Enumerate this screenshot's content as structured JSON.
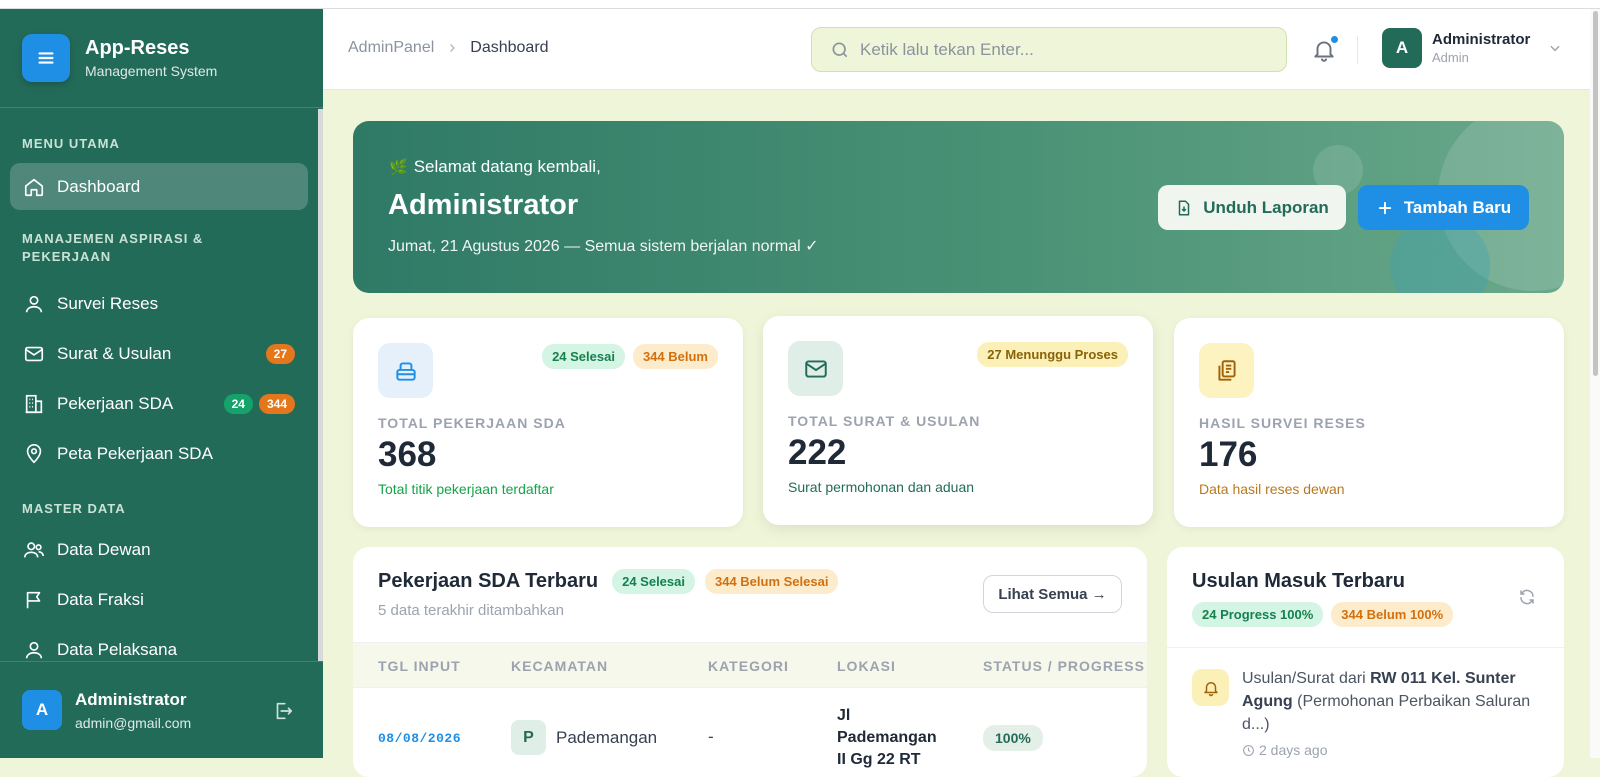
{
  "sidebar": {
    "brand_title": "App-Reses",
    "brand_subtitle": "Management System",
    "sections": [
      {
        "title": "MENU UTAMA"
      },
      {
        "title": "MANAJEMEN ASPIRASI & PEKERJAAN"
      },
      {
        "title": "MASTER DATA"
      }
    ],
    "items": [
      {
        "label": "Dashboard",
        "icon": "home-icon",
        "active": true
      },
      {
        "label": "Survei Reses",
        "icon": "user-icon"
      },
      {
        "label": "Surat & Usulan",
        "icon": "mail-icon",
        "badge": "27"
      },
      {
        "label": "Pekerjaan SDA",
        "icon": "building-icon",
        "badge_green": "24",
        "badge_orange": "344"
      },
      {
        "label": "Peta Pekerjaan SDA",
        "icon": "map-pin-icon"
      },
      {
        "label": "Data Dewan",
        "icon": "users-icon"
      },
      {
        "label": "Data Fraksi",
        "icon": "flag-icon"
      },
      {
        "label": "Data Pelaksana",
        "icon": "user-icon"
      }
    ],
    "footer": {
      "avatar": "A",
      "name": "Administrator",
      "email": "admin@gmail.com"
    }
  },
  "header": {
    "breadcrumb": [
      "AdminPanel",
      "Dashboard"
    ],
    "search_placeholder": "Ketik lalu tekan Enter...",
    "user": {
      "avatar": "A",
      "name": "Administrator",
      "role": "Admin"
    }
  },
  "hero": {
    "greeting": "Selamat datang kembali,",
    "name": "Administrator",
    "date_line": "Jumat, 21 Agustus 2026 — Semua sistem berjalan normal ✓",
    "btn_download": "Unduh Laporan",
    "btn_add": "Tambah Baru"
  },
  "stats": [
    {
      "label": "TOTAL PEKERJAAN SDA",
      "value": "368",
      "sub": "Total titik pekerjaan terdaftar",
      "pills": [
        "24 Selesai",
        "344 Belum"
      ],
      "accent": "#16a34a"
    },
    {
      "label": "TOTAL SURAT & USULAN",
      "value": "222",
      "sub": "Surat permohonan dan aduan",
      "pills": [
        "27 Menunggu Proses"
      ],
      "accent": "#236b59"
    },
    {
      "label": "HASIL SURVEI RESES",
      "value": "176",
      "sub": "Data hasil reses dewan",
      "pills": [],
      "accent": "#b7791f"
    }
  ],
  "table": {
    "title": "Pekerjaan SDA Terbaru",
    "pill_done": "24 Selesai",
    "pill_pending": "344 Belum Selesai",
    "subtitle": "5 data terakhir ditambahkan",
    "btn_all": "Lihat Semua →",
    "columns": [
      "TGL INPUT",
      "KECAMATAN",
      "KATEGORI",
      "LOKASI",
      "STATUS / PROGRESS"
    ],
    "rows": [
      {
        "date": "08/08/2026",
        "kec_initial": "P",
        "kecamatan": "Pademangan",
        "kategori": "-",
        "lokasi": "Jl Pademangan II Gg 22 RT",
        "status": "100%"
      }
    ]
  },
  "usulan": {
    "title": "Usulan Masuk Terbaru",
    "pill_progress": "24 Progress 100%",
    "pill_belum": "344 Belum 100%",
    "items": [
      {
        "prefix": "Usulan/Surat dari",
        "source": "RW 011 Kel. Sunter Agung",
        "desc": "(Permohonan Perbaikan Saluran d...)",
        "time": "2 days ago"
      }
    ]
  },
  "colors": {
    "sidebar": "#236b59",
    "accent_blue": "#1f8fe6",
    "background": "#eef5d8"
  }
}
